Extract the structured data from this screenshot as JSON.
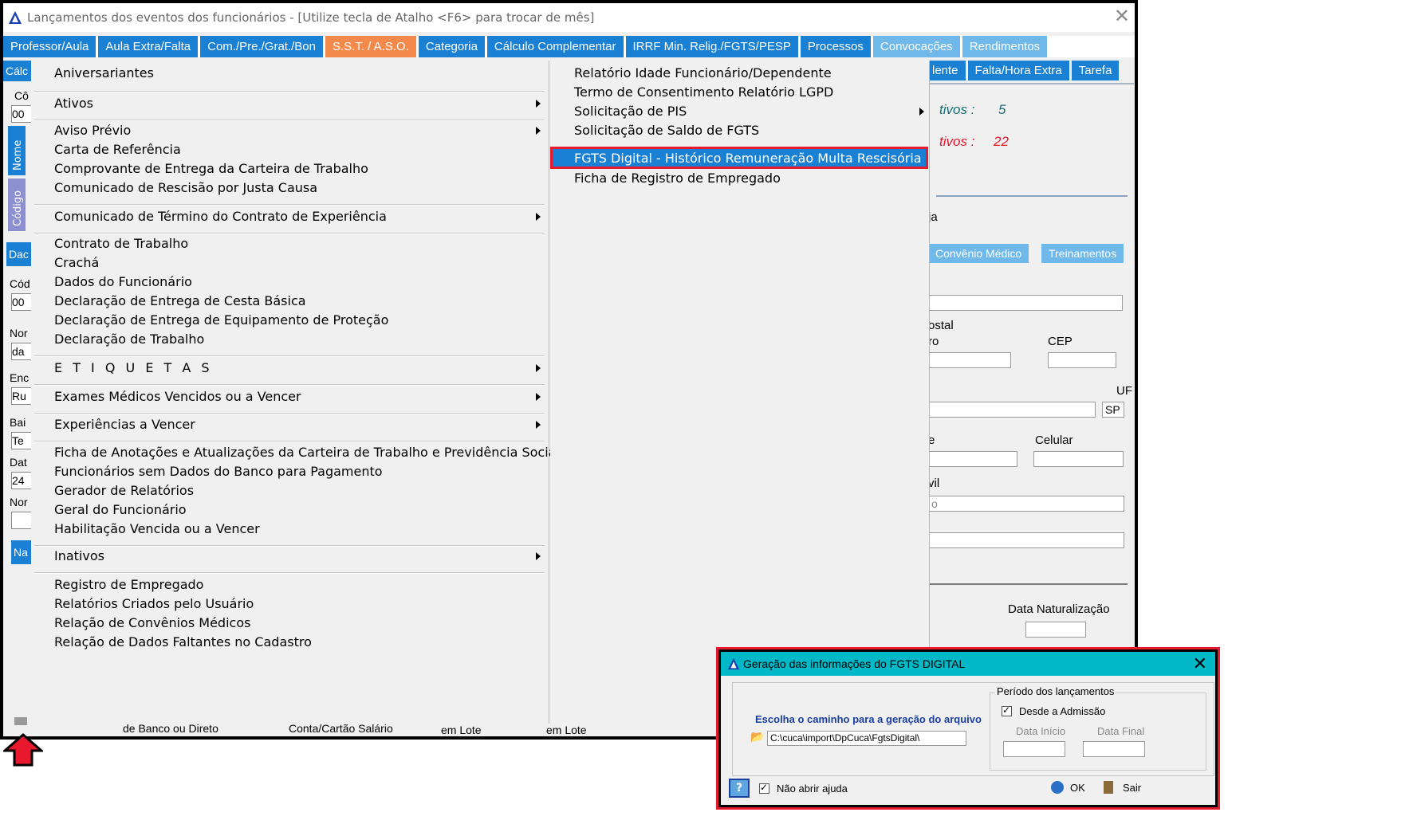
{
  "window": {
    "title": "Lançamentos dos eventos dos funcionários - [Utilize tecla de Atalho <F6> para trocar de mês]",
    "close": "✕"
  },
  "tabs_row1": [
    "Professor/Aula",
    "Aula Extra/Falta",
    "Com./Pre./Grat./Bon",
    "S.S.T. / A.S.O.",
    "Categoria",
    "Cálculo Complementar",
    "IRRF Min. Relig./FGTS/PESP",
    "Processos",
    "Convocações",
    "Rendimentos"
  ],
  "tabs_row2": [
    "lente",
    "Falta/Hora Extra",
    "Tarefa"
  ],
  "left_strip": {
    "row2_label": "Cálc",
    "label_co": "Cô",
    "field_00": "00",
    "vtab_nome": "Nome",
    "vtab_codigo": "Código",
    "dac": "Dac",
    "cod": "Cód",
    "field_00b": "00",
    "nor": "Nor",
    "da": "da",
    "enc": "Enc",
    "ru": "Ru",
    "bai": "Bai",
    "te": "Te",
    "dat": "Dat",
    "d24": "24",
    "nor2": "Nor",
    "na": "Na"
  },
  "right_area": {
    "ativos_label": "tivos :",
    "ativos_value": "5",
    "inativos_label": "tivos :",
    "inativos_value": "22",
    "ja": "ja",
    "tab_convenio": "Convênio Médico",
    "tab_treinamentos": "Treinamentos",
    "postal": "ostal",
    "ro": "ro",
    "cep": "CEP",
    "uf": "UF",
    "uf_value": "SP",
    "e": "e",
    "celular": "Celular",
    "vil": "vil",
    "o": "o",
    "data_naturalizacao": "Data Naturalização"
  },
  "menu_left": [
    {
      "label": "Aniversariantes",
      "submenu": false
    },
    {
      "label": "Ativos",
      "submenu": true
    },
    {
      "label": "Aviso Prévio",
      "submenu": true
    },
    {
      "label": "Carta de Referência",
      "submenu": false
    },
    {
      "label": "Comprovante de Entrega da Carteira de Trabalho",
      "submenu": false
    },
    {
      "label": "Comunicado de Rescisão por Justa Causa",
      "submenu": false
    },
    {
      "label": "Comunicado de Término do Contrato de Experiência",
      "submenu": true
    },
    {
      "label": "Contrato de Trabalho",
      "submenu": false
    },
    {
      "label": "Crachá",
      "submenu": false
    },
    {
      "label": "Dados do Funcionário",
      "submenu": false
    },
    {
      "label": "Declaração de Entrega de Cesta Básica",
      "submenu": false
    },
    {
      "label": "Declaração de Entrega de Equipamento de Proteção",
      "submenu": false
    },
    {
      "label": "Declaração de Trabalho",
      "submenu": false
    },
    {
      "label": "E T I Q U E T A S",
      "submenu": true
    },
    {
      "label": "Exames Médicos Vencidos ou a Vencer",
      "submenu": true
    },
    {
      "label": "Experiências a Vencer",
      "submenu": true
    },
    {
      "label": "Ficha de Anotações e Atualizações da Carteira de Trabalho e Previdência Social",
      "submenu": false
    },
    {
      "label": "Funcionários sem Dados do Banco para Pagamento",
      "submenu": false
    },
    {
      "label": "Gerador de Relatórios",
      "submenu": false
    },
    {
      "label": "Geral do Funcionário",
      "submenu": false
    },
    {
      "label": "Habilitação Vencida ou a Vencer",
      "submenu": false
    },
    {
      "label": "Inativos",
      "submenu": true
    },
    {
      "label": "Registro de Empregado",
      "submenu": false
    },
    {
      "label": "Relatórios Criados pelo Usuário",
      "submenu": false
    },
    {
      "label": "Relação de Convênios Médicos",
      "submenu": false
    },
    {
      "label": "Relação de Dados Faltantes no Cadastro",
      "submenu": false
    }
  ],
  "menu_right": [
    {
      "label": "Relatório Idade Funcionário/Dependente",
      "submenu": false
    },
    {
      "label": "Termo de Consentimento Relatório LGPD",
      "submenu": false
    },
    {
      "label": "Solicitação de PIS",
      "submenu": true
    },
    {
      "label": "Solicitação de Saldo de FGTS",
      "submenu": false
    },
    {
      "label": "FGTS Digital - Histórico Remuneração Multa Rescisória",
      "submenu": false,
      "highlighted": true
    },
    {
      "label": "Ficha de Registro de Empregado",
      "submenu": false
    }
  ],
  "bottom_strip": {
    "banco": "de Banco ou Direto",
    "conta": "Conta/Cartão Salário",
    "lote1": "em Lote",
    "lote2": "em Lote"
  },
  "dialog": {
    "title": "Geração das informações do FGTS DIGITAL",
    "choose_path_label": "Escolha o caminho para a geração do arquivo",
    "path_value": "C:\\cuca\\import\\DpCuca\\FgtsDigital\\",
    "periodo_label": "Período dos lançamentos",
    "desde_admissao": "Desde a Admissão",
    "data_inicio": "Data Início",
    "data_final": "Data Final",
    "nao_abrir_ajuda": "Não abrir ajuda",
    "ok": "OK",
    "sair": "Sair"
  },
  "colors": {
    "tab_blue": "#1a80d4",
    "tab_orange": "#f3894a",
    "tab_light": "#6fb9ea",
    "highlight_border": "#e8182d",
    "dialog_title_bg": "#00b8c8"
  }
}
